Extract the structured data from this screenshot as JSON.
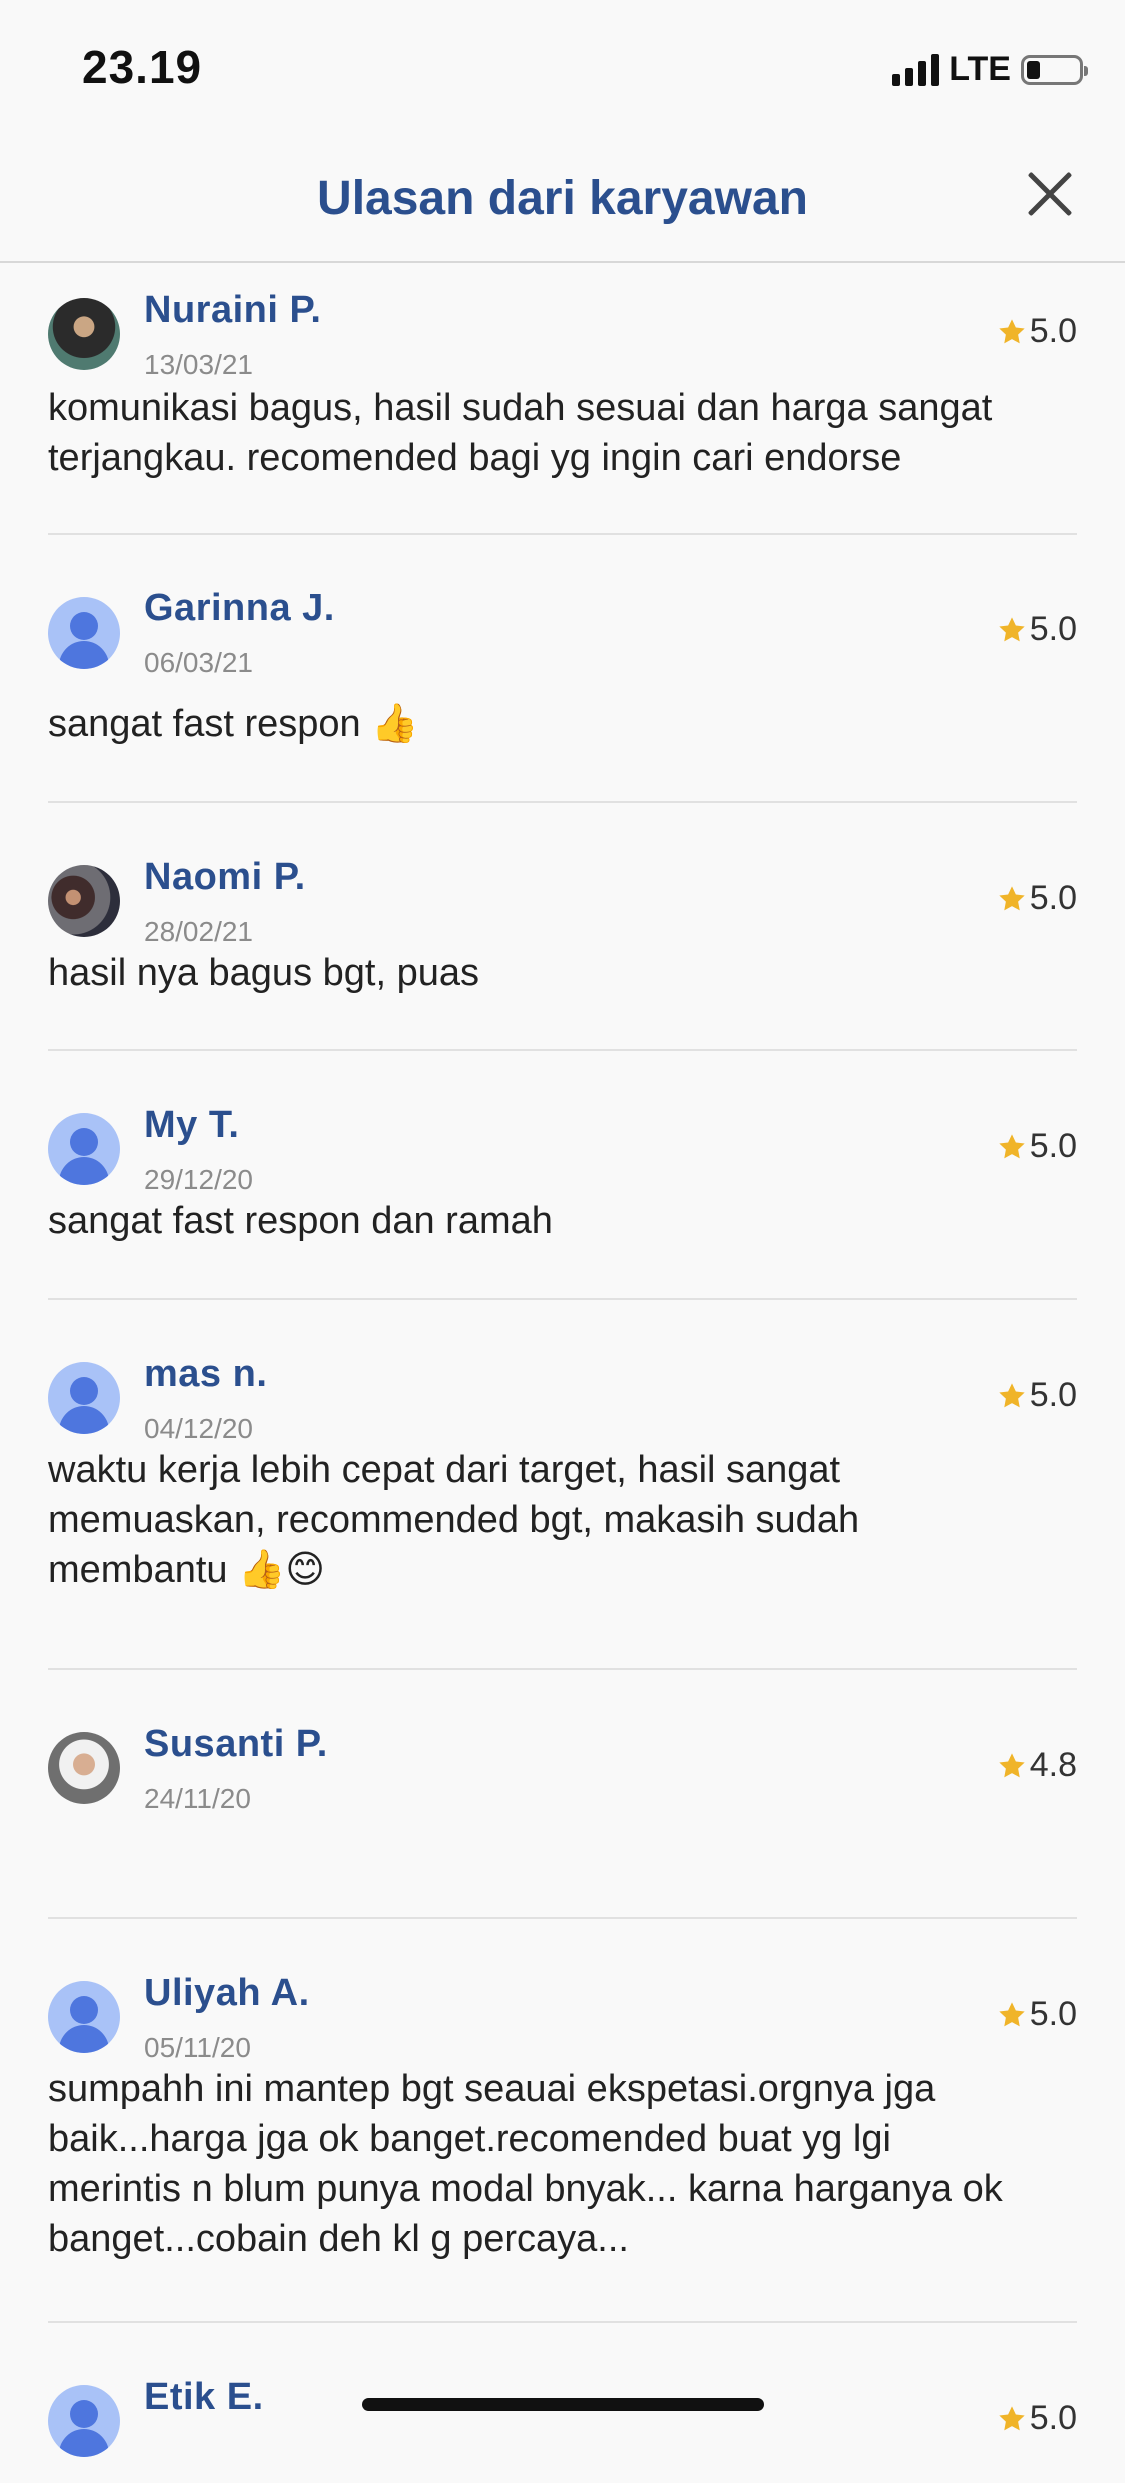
{
  "status_bar": {
    "time": "23.19",
    "network": "LTE",
    "battery_level": 0.25
  },
  "header": {
    "title": "Ulasan dari karyawan",
    "close_icon": "close-icon"
  },
  "reviews": [
    {
      "name": "Nuraini P.",
      "date": "13/03/21",
      "rating": "5.0",
      "text": "komunikasi bagus, hasil sudah sesuai dan harga sangat\nterjangkau. recomended bagi yg ingin cari endorse",
      "avatar": "photo"
    },
    {
      "name": "Garinna J.",
      "date": "06/03/21",
      "rating": "5.0",
      "text": "sangat fast respon 👍",
      "avatar": "default"
    },
    {
      "name": "Naomi P.",
      "date": "28/02/21",
      "rating": "5.0",
      "text": "hasil nya bagus bgt, puas",
      "avatar": "photo"
    },
    {
      "name": "My T.",
      "date": "29/12/20",
      "rating": "5.0",
      "text": "sangat fast respon dan ramah",
      "avatar": "default"
    },
    {
      "name": "mas n.",
      "date": "04/12/20",
      "rating": "5.0",
      "text": "waktu kerja lebih cepat dari target, hasil sangat\nmemuaskan, recommended bgt, makasih sudah\nmembantu 👍😊",
      "avatar": "default"
    },
    {
      "name": "Susanti P.",
      "date": "24/11/20",
      "rating": "4.8",
      "text": "",
      "avatar": "photo"
    },
    {
      "name": "Uliyah A.",
      "date": "05/11/20",
      "rating": "5.0",
      "text": "sumpahh ini mantep bgt seauai ekspetasi.orgnya jga\nbaik...harga jga ok banget.recomended buat yg lgi\nmerintis n blum punya modal bnyak... karna harganya ok\nbanget...cobain deh kl g percaya...",
      "avatar": "default"
    },
    {
      "name": "Etik E.",
      "date": "",
      "rating": "5.0",
      "text": "",
      "avatar": "default"
    }
  ],
  "colors": {
    "accent": "#2b4f8e",
    "star": "#f0b429",
    "avatar_bg": "#a9c2f7",
    "avatar_fg": "#4e76de"
  }
}
